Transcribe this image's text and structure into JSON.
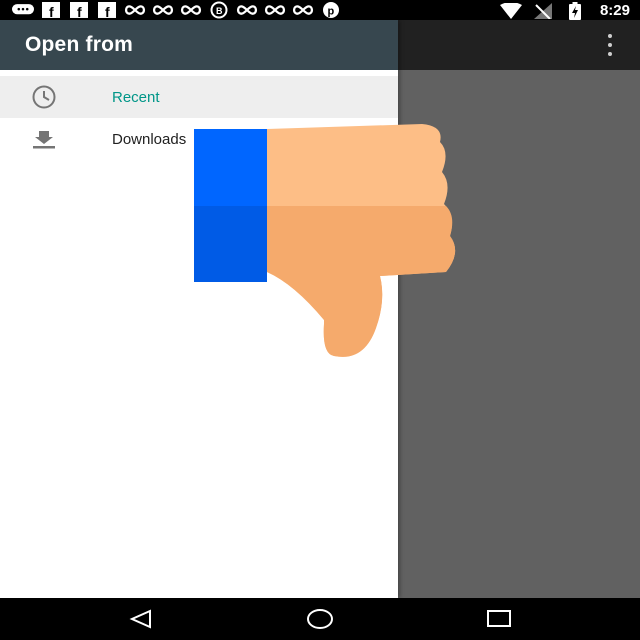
{
  "status_bar": {
    "time": "8:29",
    "notification_icons": [
      "chat-icon",
      "facebook-icon",
      "facebook-icon",
      "facebook-icon",
      "infinity-icon",
      "infinity-icon",
      "infinity-icon",
      "whatsapp-icon",
      "infinity-icon",
      "infinity-icon",
      "infinity-icon",
      "pinterest-icon"
    ],
    "system_icons": [
      "wifi-icon",
      "no-sim-icon",
      "battery-charging-icon"
    ]
  },
  "drawer": {
    "title": "Open from",
    "items": [
      {
        "label": "Recent",
        "icon": "clock-icon",
        "selected": true
      },
      {
        "label": "Downloads",
        "icon": "download-icon",
        "selected": false
      }
    ]
  },
  "app_bar": {
    "overflow_icon": "more-vert-icon"
  },
  "overlay": {
    "icon": "thumbs-down-icon"
  },
  "nav_bar": {
    "buttons": [
      "back-icon",
      "home-icon",
      "recents-icon"
    ]
  },
  "colors": {
    "drawer_header": "#37474f",
    "app_bar": "#212121",
    "scrim": "#616161",
    "selected_item_bg": "#eeeeee",
    "accent_text": "#009688",
    "sleeve_blue": "#0066ff",
    "hand": "#fdbe86"
  }
}
